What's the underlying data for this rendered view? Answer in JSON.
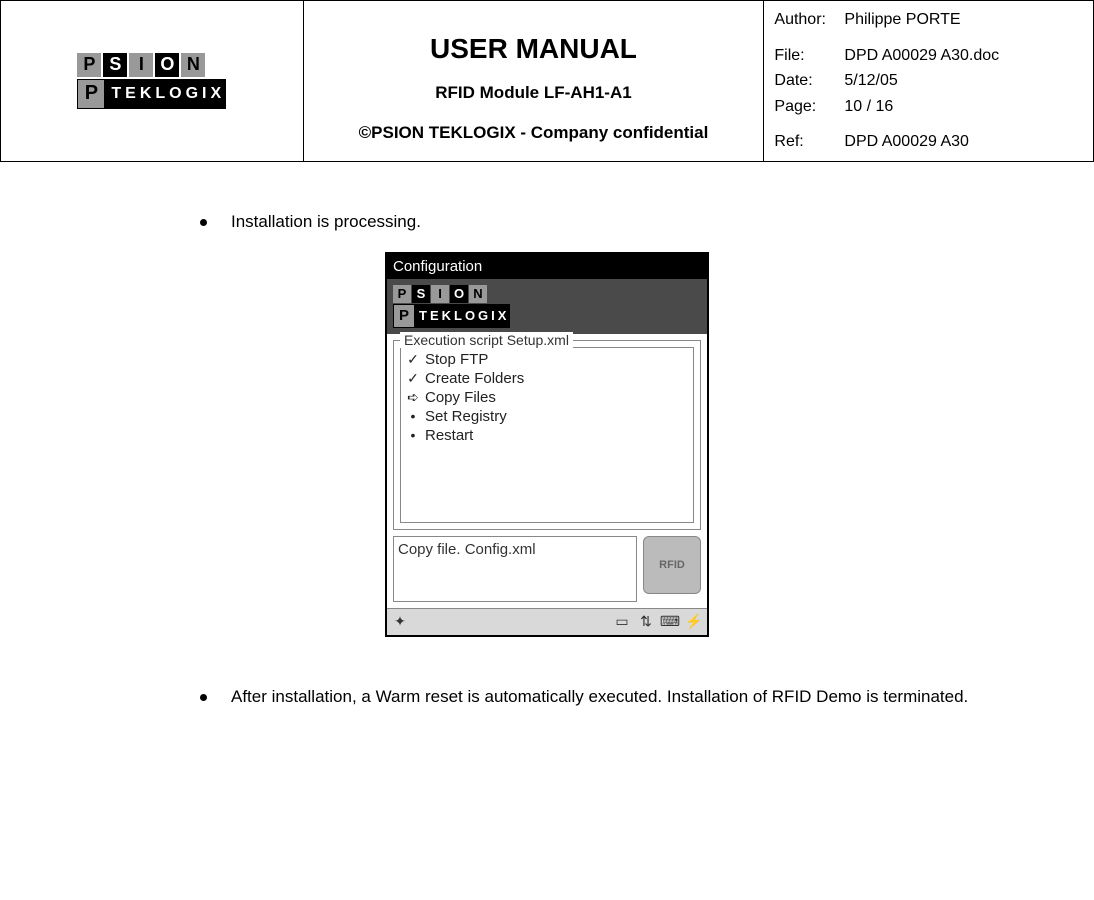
{
  "header": {
    "logo_top_letters": [
      "P",
      "S",
      "I",
      "O",
      "N"
    ],
    "logo_bottom_p": "P",
    "logo_bottom_text": "TEKLOGIX",
    "title": "USER MANUAL",
    "subtitle": "RFID Module LF-AH1-A1",
    "confidential": "©PSION TEKLOGIX - Company confidential",
    "meta": {
      "author_label": "Author:",
      "author_value": "Philippe PORTE",
      "file_label": "File:",
      "file_value": "DPD A00029 A30.doc",
      "date_label": "Date:",
      "date_value": "5/12/05",
      "page_label": "Page:",
      "page_value": "10 /  16",
      "ref_label": "Ref:",
      "ref_value": "DPD A00029 A30"
    }
  },
  "content": {
    "bullet1": "Installation is processing.",
    "bullet2": "After installation, a Warm reset is automatically executed. Installation of RFID Demo is terminated."
  },
  "screenshot": {
    "titlebar": "Configuration",
    "group_title": "Execution script Setup.xml",
    "items": [
      {
        "icon": "check",
        "label": "Stop FTP"
      },
      {
        "icon": "check",
        "label": "Create Folders"
      },
      {
        "icon": "arrow",
        "label": "Copy Files"
      },
      {
        "icon": "dot",
        "label": "Set Registry"
      },
      {
        "icon": "dot",
        "label": "Restart"
      }
    ],
    "status_text": "Copy file. Config.xml",
    "rfid_badge": "RFID"
  }
}
